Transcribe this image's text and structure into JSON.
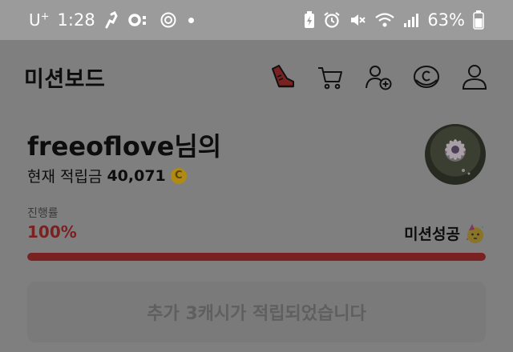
{
  "status_bar": {
    "carrier": "U",
    "carrier_sup": "+",
    "time": "1:28",
    "battery": "63%",
    "icons": [
      "running-icon",
      "record-icon",
      "settings-icon",
      "notification-dot",
      "battery-saver-icon",
      "alarm-icon",
      "mute-icon",
      "wifi-icon",
      "signal-icon",
      "battery-icon"
    ]
  },
  "header": {
    "title": "미션보드",
    "icons": [
      "sneaker-icon",
      "cart-icon",
      "add-friend-icon",
      "coin-icon",
      "profile-icon"
    ]
  },
  "profile": {
    "username": "freeoflove님의",
    "points_label": "현재 적립금",
    "points_value": "40,071",
    "coin_symbol": "C"
  },
  "progress": {
    "label": "진행률",
    "value_text": "100%",
    "fraction": 1.0,
    "status": "미션성공",
    "accent": "#7a2121"
  },
  "notice": {
    "text": "추가 3캐시가 적립되었습니다"
  }
}
